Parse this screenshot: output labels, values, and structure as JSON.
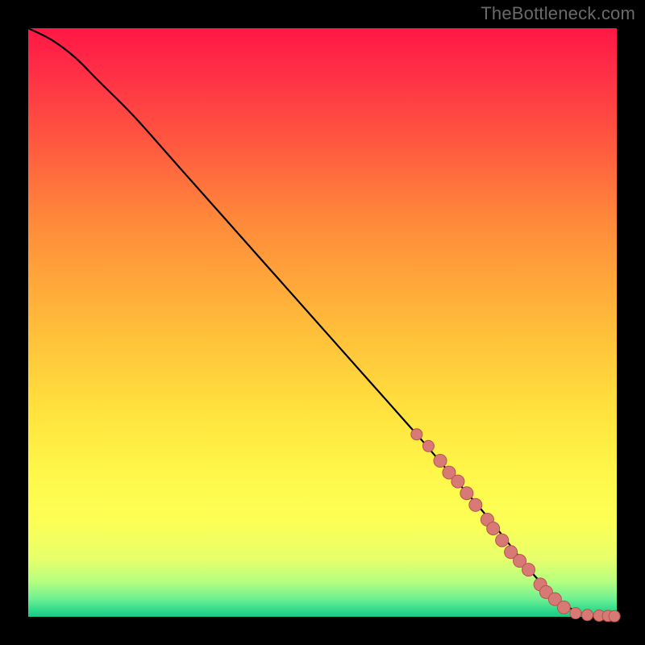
{
  "watermark": "TheBottleneck.com",
  "colors": {
    "page_bg": "#000000",
    "curve": "#000000",
    "dot_fill": "#d77a76",
    "dot_stroke": "#b9524e"
  },
  "chart_data": {
    "type": "line",
    "title": "",
    "xlabel": "",
    "ylabel": "",
    "xlim": [
      0,
      100
    ],
    "ylim": [
      0,
      100
    ],
    "grid": false,
    "legend": null,
    "series": [
      {
        "name": "curve",
        "kind": "line",
        "x": [
          0,
          4,
          8,
          12,
          18,
          26,
          34,
          42,
          50,
          58,
          66,
          72,
          78,
          82,
          86,
          88,
          90,
          92,
          94,
          96,
          98,
          100
        ],
        "y": [
          100,
          98,
          95,
          91,
          85,
          76,
          67,
          58,
          49,
          40,
          31,
          24,
          17,
          12,
          7,
          5,
          3,
          1.5,
          0.6,
          0.2,
          0.1,
          0.1
        ]
      },
      {
        "name": "markers",
        "kind": "scatter",
        "x": [
          66,
          68,
          70,
          71.5,
          73,
          74.5,
          76,
          78,
          79,
          80.5,
          82,
          83.5,
          85,
          87,
          88,
          89.5,
          91,
          93,
          95,
          97,
          98.5,
          99.6
        ],
        "y": [
          31,
          29,
          26.5,
          24.5,
          23,
          21,
          19,
          16.5,
          15,
          13,
          11,
          9.5,
          8,
          5.5,
          4.2,
          3,
          1.6,
          0.6,
          0.3,
          0.2,
          0.15,
          0.1
        ],
        "r": [
          7,
          7,
          8,
          8,
          8,
          8,
          8,
          8,
          8,
          8,
          8,
          8,
          8,
          8,
          8,
          8,
          8,
          7,
          7,
          7,
          7,
          7
        ]
      }
    ]
  }
}
